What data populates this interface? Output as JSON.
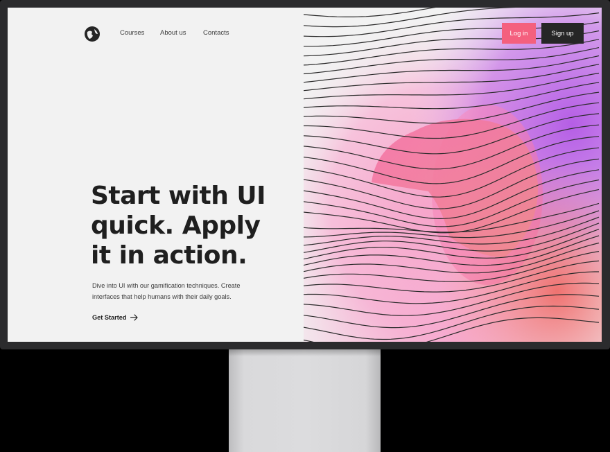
{
  "nav": {
    "links": [
      "Courses",
      "About us",
      "Contacts"
    ],
    "login_label": "Log in",
    "signup_label": "Sign up"
  },
  "hero": {
    "headline_lines": [
      "Start with UI",
      "quick. Apply",
      "it in action."
    ],
    "subtext_lines": [
      "Dive into UI with our gamification techniques. Create",
      "interfaces that help humans with their daily goals."
    ],
    "cta_label": "Get Started"
  },
  "colors": {
    "background": "#f2f2f2",
    "text": "#1f1f1f",
    "login_button": "#f4607e",
    "signup_button": "#262626",
    "gradient_pink": "#f7a8cf",
    "gradient_purple": "#b45ee6",
    "gradient_coral": "#f0736a",
    "monitor_bezel": "#2b2b2d",
    "stand": "#d9d9db"
  },
  "icons": {
    "logo": "globe-logo-icon",
    "cta_arrow": "arrow-right-icon"
  }
}
